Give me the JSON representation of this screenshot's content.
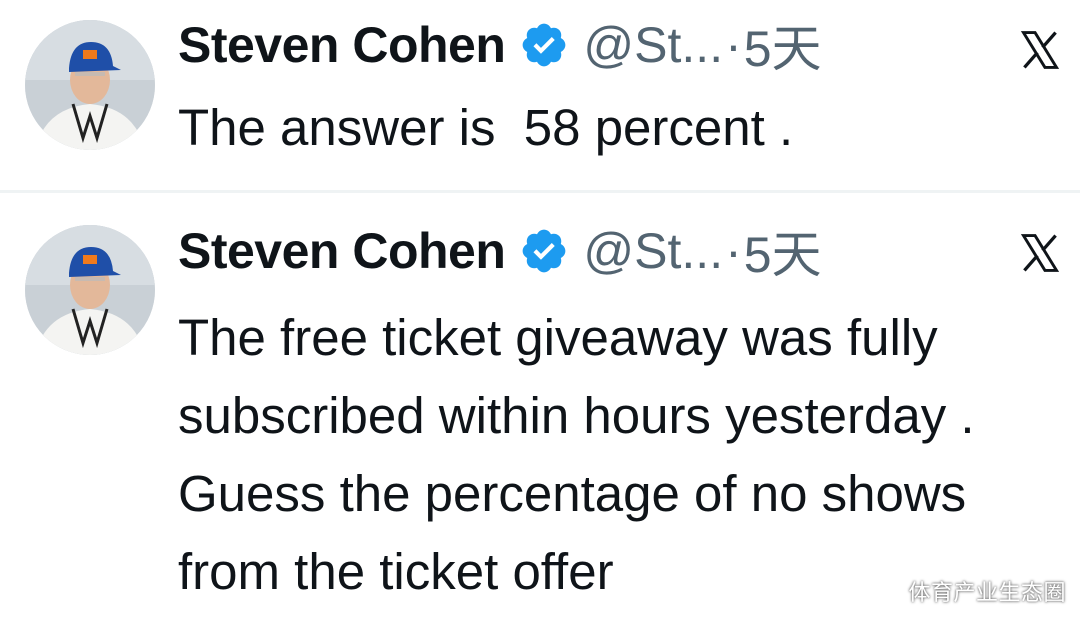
{
  "tweets": [
    {
      "author_name": "Steven Cohen",
      "handle": "@St...",
      "separator": "·",
      "time": "5天",
      "text": "The answer is  58 percent ."
    },
    {
      "author_name": "Steven Cohen",
      "handle": "@St...",
      "separator": "·",
      "time": "5天",
      "text": "The free ticket giveaway was fully subscribed within hours yesterday . Guess the percentage of no shows from the ticket offer"
    }
  ],
  "icons": {
    "verified": "verified-badge-icon",
    "platform": "x-logo-icon"
  },
  "colors": {
    "verified_blue": "#1d9bf0",
    "secondary_text": "#536471",
    "primary_text": "#0f1419",
    "divider": "#eff3f4"
  },
  "watermark": "体育产业生态圈"
}
